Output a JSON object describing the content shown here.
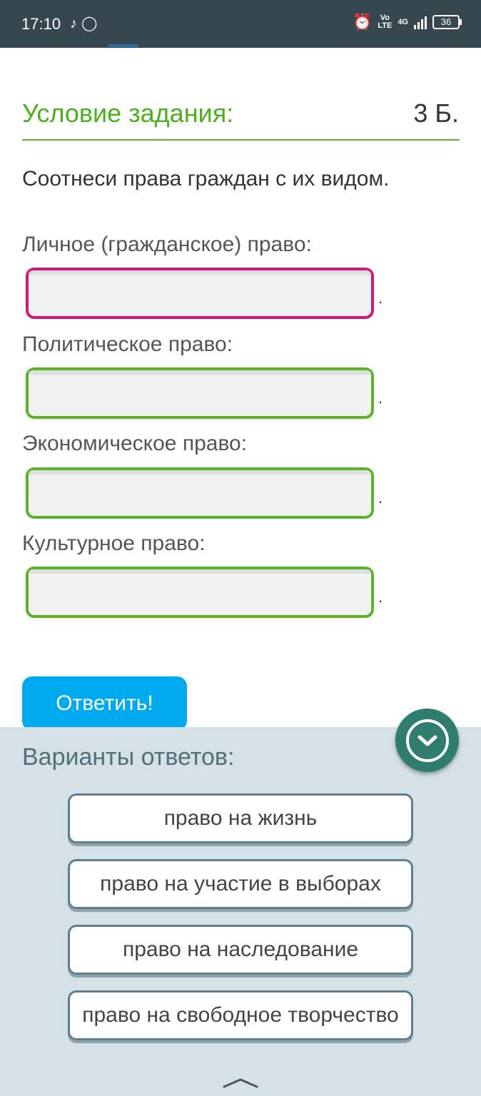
{
  "status_bar": {
    "time": "17:10",
    "notification_icons": [
      "tiktok-icon",
      "chat-icon"
    ],
    "alarm_icon": "alarm-icon",
    "network_top": "Vo",
    "network_bottom": "LTE",
    "network_type": "4G",
    "battery_level": "36"
  },
  "task": {
    "title": "Условие задания:",
    "points": "3 Б.",
    "question": "Соотнеси права граждан с их видом."
  },
  "fields": [
    {
      "label": "Личное (гражданское) право:",
      "value": "",
      "suffix": ".",
      "state": "active"
    },
    {
      "label": "Политическое право:",
      "value": "",
      "suffix": ".",
      "state": "normal"
    },
    {
      "label": "Экономическое право:",
      "value": "",
      "suffix": ".",
      "state": "normal"
    },
    {
      "label": "Культурное право:",
      "value": "",
      "suffix": ".",
      "state": "normal"
    }
  ],
  "submit_label": "Ответить!",
  "answers": {
    "title": "Варианты ответов:",
    "options": [
      "право на жизнь",
      "право на участие в выборах",
      "право на наследование",
      "право на свободное творчество"
    ]
  },
  "colors": {
    "accent_green": "#5cb32a",
    "active_border": "#d0177c",
    "submit_blue": "#00aaf0",
    "panel_bg": "#d4e1e7",
    "fab_teal": "#2e7d6e"
  }
}
